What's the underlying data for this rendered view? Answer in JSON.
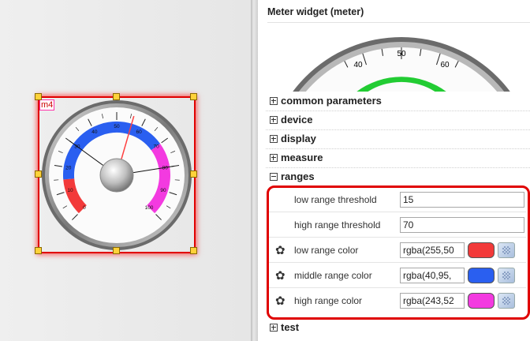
{
  "widget": {
    "id_tag": "m4",
    "scale_labels": [
      "0",
      "10",
      "20",
      "30",
      "40",
      "50",
      "60",
      "70",
      "80",
      "90",
      "100"
    ],
    "value": 56,
    "low_threshold": 15,
    "high_threshold": 70,
    "low_color": "#f23a3a",
    "middle_color": "#2a5ff0",
    "high_color": "#f33ae0"
  },
  "panel": {
    "title": "Meter widget (meter)",
    "preview_labels": [
      "40",
      "50",
      "60"
    ],
    "sections": {
      "common": "common parameters",
      "device": "device",
      "display": "display",
      "measure": "measure",
      "ranges": "ranges",
      "test": "test"
    },
    "rows": {
      "low_threshold": {
        "label": "low range threshold",
        "value": "15"
      },
      "high_threshold": {
        "label": "high range threshold",
        "value": "70"
      },
      "low_color": {
        "label": "low range color",
        "value": "rgba(255,50",
        "swatch": "#f23a3a"
      },
      "middle_color": {
        "label": "middle range color",
        "value": "rgba(40,95,",
        "swatch": "#2a5ff0"
      },
      "high_color": {
        "label": "high range color",
        "value": "rgba(243,52",
        "swatch": "#f33ae0"
      }
    }
  }
}
